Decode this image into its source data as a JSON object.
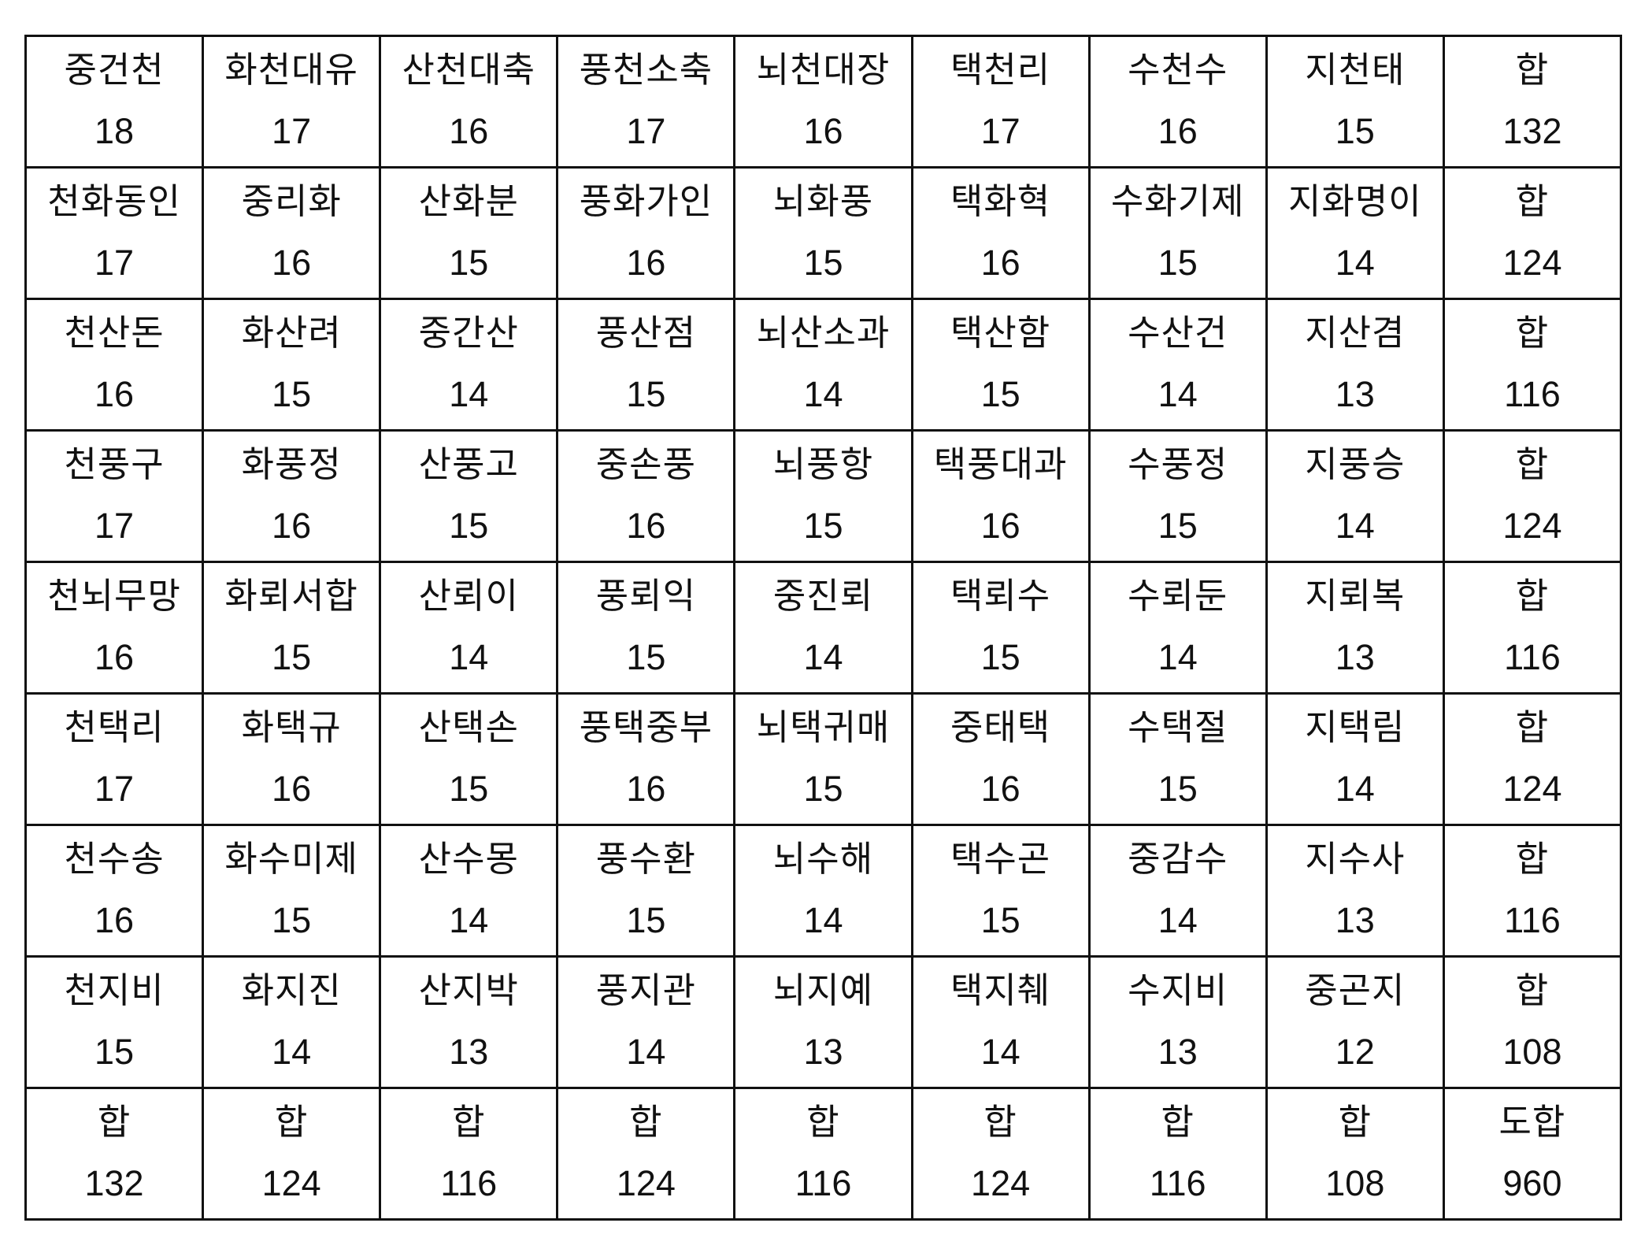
{
  "table": {
    "rows": [
      [
        {
          "name": "중건천",
          "value": "18"
        },
        {
          "name": "화천대유",
          "value": "17"
        },
        {
          "name": "산천대축",
          "value": "16"
        },
        {
          "name": "풍천소축",
          "value": "17"
        },
        {
          "name": "뇌천대장",
          "value": "16"
        },
        {
          "name": "택천리",
          "value": "17"
        },
        {
          "name": "수천수",
          "value": "16"
        },
        {
          "name": "지천태",
          "value": "15"
        },
        {
          "name": "합",
          "value": "132"
        }
      ],
      [
        {
          "name": "천화동인",
          "value": "17"
        },
        {
          "name": "중리화",
          "value": "16"
        },
        {
          "name": "산화분",
          "value": "15"
        },
        {
          "name": "풍화가인",
          "value": "16"
        },
        {
          "name": "뇌화풍",
          "value": "15"
        },
        {
          "name": "택화혁",
          "value": "16"
        },
        {
          "name": "수화기제",
          "value": "15"
        },
        {
          "name": "지화명이",
          "value": "14"
        },
        {
          "name": "합",
          "value": "124"
        }
      ],
      [
        {
          "name": "천산돈",
          "value": "16"
        },
        {
          "name": "화산려",
          "value": "15"
        },
        {
          "name": "중간산",
          "value": "14"
        },
        {
          "name": "풍산점",
          "value": "15"
        },
        {
          "name": "뇌산소과",
          "value": "14"
        },
        {
          "name": "택산함",
          "value": "15"
        },
        {
          "name": "수산건",
          "value": "14"
        },
        {
          "name": "지산겸",
          "value": "13"
        },
        {
          "name": "합",
          "value": "116"
        }
      ],
      [
        {
          "name": "천풍구",
          "value": "17"
        },
        {
          "name": "화풍정",
          "value": "16"
        },
        {
          "name": "산풍고",
          "value": "15"
        },
        {
          "name": "중손풍",
          "value": "16"
        },
        {
          "name": "뇌풍항",
          "value": "15"
        },
        {
          "name": "택풍대과",
          "value": "16"
        },
        {
          "name": "수풍정",
          "value": "15"
        },
        {
          "name": "지풍승",
          "value": "14"
        },
        {
          "name": "합",
          "value": "124"
        }
      ],
      [
        {
          "name": "천뇌무망",
          "value": "16"
        },
        {
          "name": "화뢰서합",
          "value": "15"
        },
        {
          "name": "산뢰이",
          "value": "14"
        },
        {
          "name": "풍뢰익",
          "value": "15"
        },
        {
          "name": "중진뢰",
          "value": "14"
        },
        {
          "name": "택뢰수",
          "value": "15"
        },
        {
          "name": "수뢰둔",
          "value": "14"
        },
        {
          "name": "지뢰복",
          "value": "13"
        },
        {
          "name": "합",
          "value": "116"
        }
      ],
      [
        {
          "name": "천택리",
          "value": "17"
        },
        {
          "name": "화택규",
          "value": "16"
        },
        {
          "name": "산택손",
          "value": "15"
        },
        {
          "name": "풍택중부",
          "value": "16"
        },
        {
          "name": "뇌택귀매",
          "value": "15"
        },
        {
          "name": "중태택",
          "value": "16"
        },
        {
          "name": "수택절",
          "value": "15"
        },
        {
          "name": "지택림",
          "value": "14"
        },
        {
          "name": "합",
          "value": "124"
        }
      ],
      [
        {
          "name": "천수송",
          "value": "16"
        },
        {
          "name": "화수미제",
          "value": "15"
        },
        {
          "name": "산수몽",
          "value": "14"
        },
        {
          "name": "풍수환",
          "value": "15"
        },
        {
          "name": "뇌수해",
          "value": "14"
        },
        {
          "name": "택수곤",
          "value": "15"
        },
        {
          "name": "중감수",
          "value": "14"
        },
        {
          "name": "지수사",
          "value": "13"
        },
        {
          "name": "합",
          "value": "116"
        }
      ],
      [
        {
          "name": "천지비",
          "value": "15"
        },
        {
          "name": "화지진",
          "value": "14"
        },
        {
          "name": "산지박",
          "value": "13"
        },
        {
          "name": "풍지관",
          "value": "14"
        },
        {
          "name": "뇌지예",
          "value": "13"
        },
        {
          "name": "택지췌",
          "value": "14"
        },
        {
          "name": "수지비",
          "value": "13"
        },
        {
          "name": "중곤지",
          "value": "12"
        },
        {
          "name": "합",
          "value": "108"
        }
      ],
      [
        {
          "name": "합",
          "value": "132"
        },
        {
          "name": "합",
          "value": "124"
        },
        {
          "name": "합",
          "value": "116"
        },
        {
          "name": "합",
          "value": "124"
        },
        {
          "name": "합",
          "value": "116"
        },
        {
          "name": "합",
          "value": "124"
        },
        {
          "name": "합",
          "value": "116"
        },
        {
          "name": "합",
          "value": "108"
        },
        {
          "name": "도합",
          "value": "960"
        }
      ]
    ]
  }
}
